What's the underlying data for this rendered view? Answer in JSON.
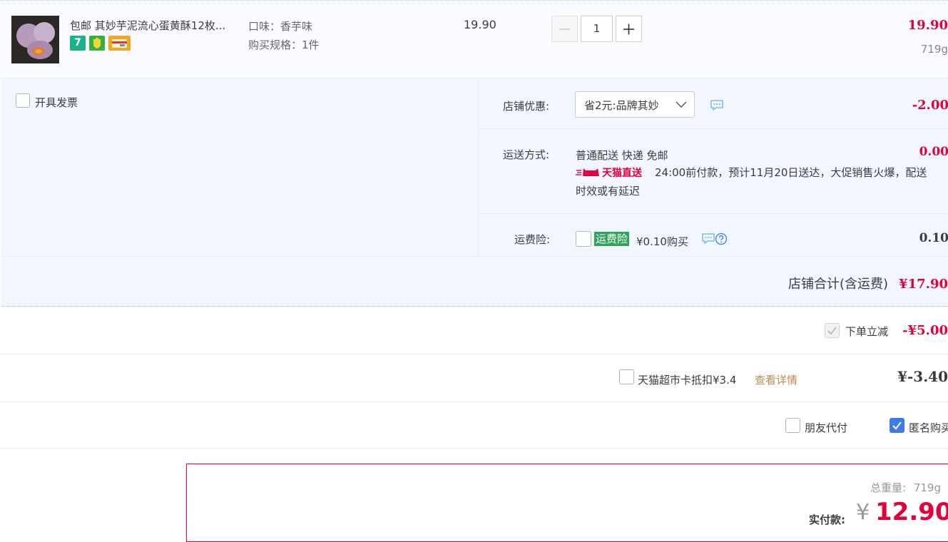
{
  "product": {
    "title": "包邮 其妙芋泥流心蛋黄酥12枚...",
    "flavor": "口味：香芋味",
    "spec": "购买规格：1件",
    "unit_price": "19.90",
    "quantity": "1",
    "subtotal": "19.90",
    "weight": "719g",
    "badges": [
      {
        "icon": "seven-day-return-icon",
        "text": "7",
        "color": "#1bb28a"
      },
      {
        "icon": "shield-guarantee-icon",
        "text": "",
        "color": "#35b23c"
      },
      {
        "icon": "card-payment-icon",
        "text": "",
        "color": "#f5a523"
      }
    ]
  },
  "invoice": {
    "label": "开具发票"
  },
  "shop": {
    "discount": {
      "label": "店铺优惠:",
      "selected": "省2元:品牌其妙",
      "amount": "-2.00"
    },
    "shipping": {
      "label": "运送方式:",
      "method": "普通配送 快递 免邮",
      "amount": "0.00",
      "tmall_tag": "天猫直送",
      "note_line1": "24:00前付款，预计11月20日送达，大促销售火爆，配送",
      "note_line2": "时效或有延迟"
    },
    "insurance": {
      "label": "运费险:",
      "tag": "运费险",
      "price": "¥0.10购买",
      "amount": "0.10"
    },
    "total_label": "店铺合计(含运费)",
    "total_value": "¥17.90"
  },
  "instant_discount": {
    "label": "下单立减",
    "amount": "-¥5.00"
  },
  "supermarket_card": {
    "label": "天猫超市卡抵扣¥3.4",
    "link": "查看详情",
    "amount": "¥-3.40"
  },
  "options": {
    "friend_pay": "朋友代付",
    "anonymous": "匿名购买"
  },
  "summary": {
    "weight_label": "总重量:",
    "weight_value": "719g",
    "pay_label": "实付款:",
    "currency": "¥",
    "pay_value": "12.90"
  },
  "colors": {
    "accent_red": "#e4003a",
    "checkbox_blue": "#3c7be8",
    "insurance_green": "#2fa55a"
  }
}
